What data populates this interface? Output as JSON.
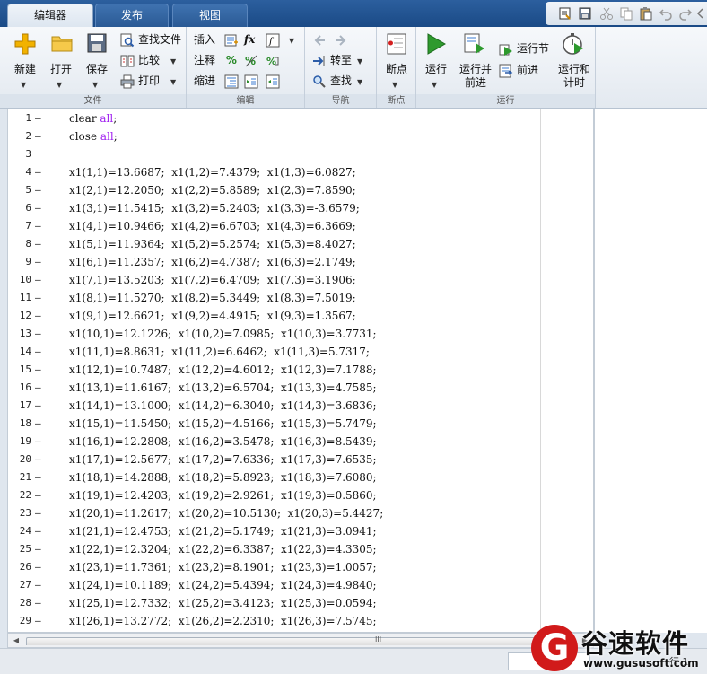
{
  "tabs": [
    {
      "label": "编辑器",
      "active": true
    },
    {
      "label": "发布",
      "active": false
    },
    {
      "label": "视图",
      "active": false
    }
  ],
  "ribbon": {
    "file": {
      "section_label": "文件",
      "new_label": "新建",
      "open_label": "打开",
      "save_label": "保存",
      "find_files_label": "查找文件",
      "compare_label": "比较",
      "print_label": "打印"
    },
    "edit": {
      "section_label": "编辑",
      "insert_label": "插入",
      "comment_label": "注释",
      "indent_label": "缩进",
      "fx_label": "fx"
    },
    "navigate": {
      "section_label": "导航",
      "goto_label": "转至",
      "find_label": "查找"
    },
    "breakpoints": {
      "section_label": "断点",
      "breakpoints_label": "断点"
    },
    "run": {
      "section_label": "运行",
      "run_label": "运行",
      "run_advance_label": "运行并\n前进",
      "run_section_label": "运行节",
      "advance_label": "前进",
      "run_time_label": "运行和\n计时"
    }
  },
  "editor": {
    "keywords": [
      "all"
    ],
    "lines": [
      {
        "n": "1",
        "dash": "–",
        "code": "clear all;"
      },
      {
        "n": "2",
        "dash": "–",
        "code": "close all;"
      },
      {
        "n": "3",
        "dash": "",
        "code": ""
      },
      {
        "n": "4",
        "dash": "–",
        "code": "x1(1,1)=13.6687;  x1(1,2)=7.4379;  x1(1,3)=6.0827;"
      },
      {
        "n": "5",
        "dash": "–",
        "code": "x1(2,1)=12.2050;  x1(2,2)=5.8589;  x1(2,3)=7.8590;"
      },
      {
        "n": "6",
        "dash": "–",
        "code": "x1(3,1)=11.5415;  x1(3,2)=5.2403;  x1(3,3)=-3.6579;"
      },
      {
        "n": "7",
        "dash": "–",
        "code": "x1(4,1)=10.9466;  x1(4,2)=6.6703;  x1(4,3)=6.3669;"
      },
      {
        "n": "8",
        "dash": "–",
        "code": "x1(5,1)=11.9364;  x1(5,2)=5.2574;  x1(5,3)=8.4027;"
      },
      {
        "n": "9",
        "dash": "–",
        "code": "x1(6,1)=11.2357;  x1(6,2)=4.7387;  x1(6,3)=2.1749;"
      },
      {
        "n": "10",
        "dash": "–",
        "code": "x1(7,1)=13.5203;  x1(7,2)=6.4709;  x1(7,3)=3.1906;"
      },
      {
        "n": "11",
        "dash": "–",
        "code": "x1(8,1)=11.5270;  x1(8,2)=5.3449;  x1(8,3)=7.5019;"
      },
      {
        "n": "12",
        "dash": "–",
        "code": "x1(9,1)=12.6621;  x1(9,2)=4.4915;  x1(9,3)=1.3567;"
      },
      {
        "n": "13",
        "dash": "–",
        "code": "x1(10,1)=12.1226;  x1(10,2)=7.0985;  x1(10,3)=3.7731;"
      },
      {
        "n": "14",
        "dash": "–",
        "code": "x1(11,1)=8.8631;  x1(11,2)=6.6462;  x1(11,3)=5.7317;"
      },
      {
        "n": "15",
        "dash": "–",
        "code": "x1(12,1)=10.7487;  x1(12,2)=4.6012;  x1(12,3)=7.1788;"
      },
      {
        "n": "16",
        "dash": "–",
        "code": "x1(13,1)=11.6167;  x1(13,2)=6.5704;  x1(13,3)=4.7585;"
      },
      {
        "n": "17",
        "dash": "–",
        "code": "x1(14,1)=13.1000;  x1(14,2)=6.3040;  x1(14,3)=3.6836;"
      },
      {
        "n": "18",
        "dash": "–",
        "code": "x1(15,1)=11.5450;  x1(15,2)=4.5166;  x1(15,3)=5.7479;"
      },
      {
        "n": "19",
        "dash": "–",
        "code": "x1(16,1)=12.2808;  x1(16,2)=3.5478;  x1(16,3)=8.5439;"
      },
      {
        "n": "20",
        "dash": "–",
        "code": "x1(17,1)=12.5677;  x1(17,2)=7.6336;  x1(17,3)=7.6535;"
      },
      {
        "n": "21",
        "dash": "–",
        "code": "x1(18,1)=14.2888;  x1(18,2)=5.8923;  x1(18,3)=7.6080;"
      },
      {
        "n": "22",
        "dash": "–",
        "code": "x1(19,1)=12.4203;  x1(19,2)=2.9261;  x1(19,3)=0.5860;"
      },
      {
        "n": "23",
        "dash": "–",
        "code": "x1(20,1)=11.2617;  x1(20,2)=10.5130;  x1(20,3)=5.4427;"
      },
      {
        "n": "24",
        "dash": "–",
        "code": "x1(21,1)=12.4753;  x1(21,2)=5.1749;  x1(21,3)=3.0941;"
      },
      {
        "n": "25",
        "dash": "–",
        "code": "x1(22,1)=12.3204;  x1(22,2)=6.3387;  x1(22,3)=4.3305;"
      },
      {
        "n": "26",
        "dash": "–",
        "code": "x1(23,1)=11.7361;  x1(23,2)=8.1901;  x1(23,3)=1.0057;"
      },
      {
        "n": "27",
        "dash": "–",
        "code": "x1(24,1)=10.1189;  x1(24,2)=5.4394;  x1(24,3)=4.9840;"
      },
      {
        "n": "28",
        "dash": "–",
        "code": "x1(25,1)=12.7332;  x1(25,2)=3.4123;  x1(25,3)=0.0594;"
      },
      {
        "n": "29",
        "dash": "–",
        "code": "x1(26,1)=13.2772;  x1(26,2)=2.2310;  x1(26,3)=7.5745;"
      }
    ]
  },
  "scrollbar": {
    "thumb_grip": "III"
  },
  "status": {
    "position": "行 1"
  },
  "watermark": {
    "logo_letter": "G",
    "title": "谷速软件",
    "url": "www.gususoft.com"
  },
  "colors": {
    "keyword": "#a020f0",
    "tabbar": "#1f4f8c",
    "run_green": "#2e9a2e"
  }
}
